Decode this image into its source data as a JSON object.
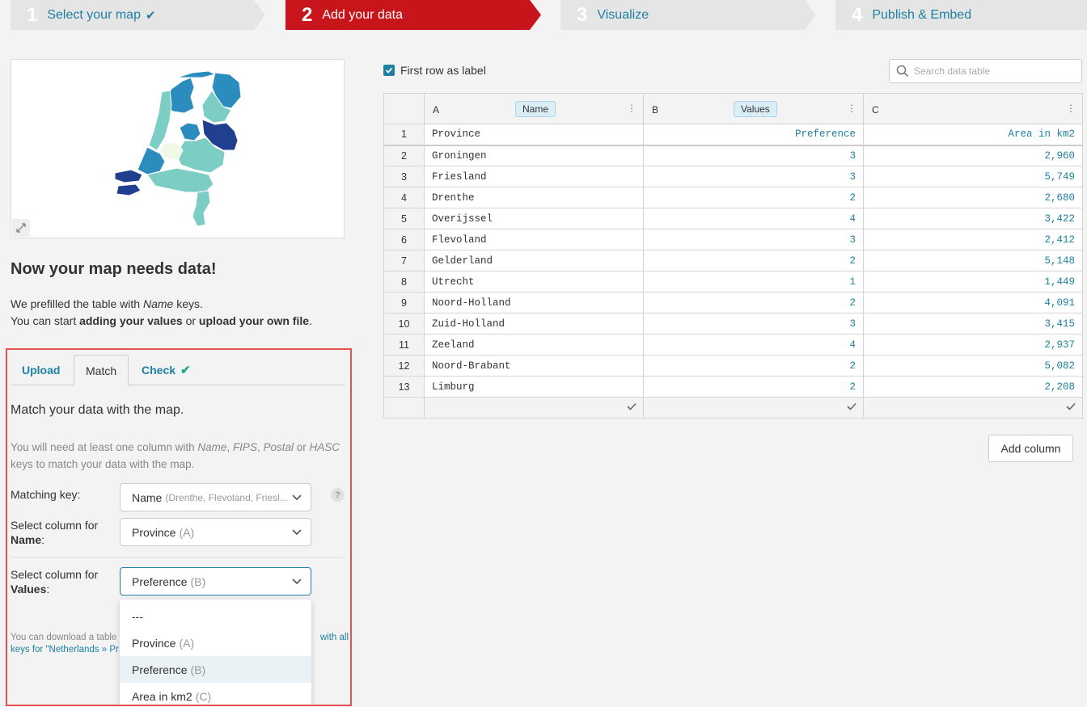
{
  "steps": [
    {
      "num": "1",
      "label": "Select your map",
      "done": true
    },
    {
      "num": "2",
      "label": "Add your data",
      "active": true
    },
    {
      "num": "3",
      "label": "Visualize"
    },
    {
      "num": "4",
      "label": "Publish & Embed"
    }
  ],
  "intro": {
    "headline": "Now your map needs data!",
    "line1_prefix": "We prefilled the table with ",
    "line1_em": "Name",
    "line1_suffix": " keys.",
    "line2_prefix": "You can start ",
    "line2_b1": "adding your values",
    "line2_mid": " or ",
    "line2_b2": "upload your own file",
    "line2_suffix": "."
  },
  "panel": {
    "tabs": [
      "Upload",
      "Match",
      "Check"
    ],
    "active_tab": "Match",
    "title": "Match your data with the map.",
    "help": {
      "p1": "You will need at least one column with ",
      "k1": "Name",
      "s1": ", ",
      "k2": "FIPS",
      "s2": ", ",
      "k3": "Postal",
      "s3": " or ",
      "k4": "HASC",
      "p2": " keys to match your data with the map."
    },
    "matching_key": {
      "label": "Matching key:",
      "value": "Name",
      "detail": "(Drenthe, Flevoland, Friesl..."
    },
    "name_col": {
      "label1": "Select column for",
      "label2": "Name",
      "label3": ":",
      "value": "Province",
      "detail": "(A)"
    },
    "values_col": {
      "label1": "Select column for",
      "label2": "Values",
      "label3": ":",
      "value": "Preference",
      "detail": "(B)"
    },
    "help_mark": "?",
    "download": {
      "prefix": "You can download a table",
      "link1": "with all",
      "link2": "keys for \"Netherlands » Pr"
    },
    "dropdown": [
      {
        "label": "---",
        "detail": ""
      },
      {
        "label": "Province",
        "detail": "(A)"
      },
      {
        "label": "Preference",
        "detail": "(B)",
        "selected": true
      },
      {
        "label": "Area in km2",
        "detail": "(C)"
      }
    ]
  },
  "table_controls": {
    "first_row_label": "First row as label",
    "first_row_checked": true,
    "search_placeholder": "Search data table"
  },
  "columns": [
    {
      "letter": "A",
      "tag": "Name"
    },
    {
      "letter": "B",
      "tag": "Values"
    },
    {
      "letter": "C",
      "tag": ""
    }
  ],
  "header_row": {
    "n": "1",
    "a": "Province",
    "b": "Preference",
    "c": "Area in km2"
  },
  "rows": [
    {
      "n": "2",
      "a": "Groningen",
      "b": "3",
      "c": "2,960"
    },
    {
      "n": "3",
      "a": "Friesland",
      "b": "3",
      "c": "5,749"
    },
    {
      "n": "4",
      "a": "Drenthe",
      "b": "2",
      "c": "2,680"
    },
    {
      "n": "5",
      "a": "Overijssel",
      "b": "4",
      "c": "3,422"
    },
    {
      "n": "6",
      "a": "Flevoland",
      "b": "3",
      "c": "2,412"
    },
    {
      "n": "7",
      "a": "Gelderland",
      "b": "2",
      "c": "5,148"
    },
    {
      "n": "8",
      "a": "Utrecht",
      "b": "1",
      "c": "1,449"
    },
    {
      "n": "9",
      "a": "Noord-Holland",
      "b": "2",
      "c": "4,091"
    },
    {
      "n": "10",
      "a": "Zuid-Holland",
      "b": "3",
      "c": "3,415"
    },
    {
      "n": "11",
      "a": "Zeeland",
      "b": "4",
      "c": "2,937"
    },
    {
      "n": "12",
      "a": "Noord-Brabant",
      "b": "2",
      "c": "5,082"
    },
    {
      "n": "13",
      "a": "Limburg",
      "b": "2",
      "c": "2,208"
    }
  ],
  "add_column_label": "Add column",
  "colors": {
    "accent": "#1d81a2",
    "active_step": "#c8151b",
    "check_green": "#19a889",
    "map_scale": [
      "#f0f9e8",
      "#7ccdc4",
      "#2b8cbe",
      "#213f8f"
    ]
  }
}
